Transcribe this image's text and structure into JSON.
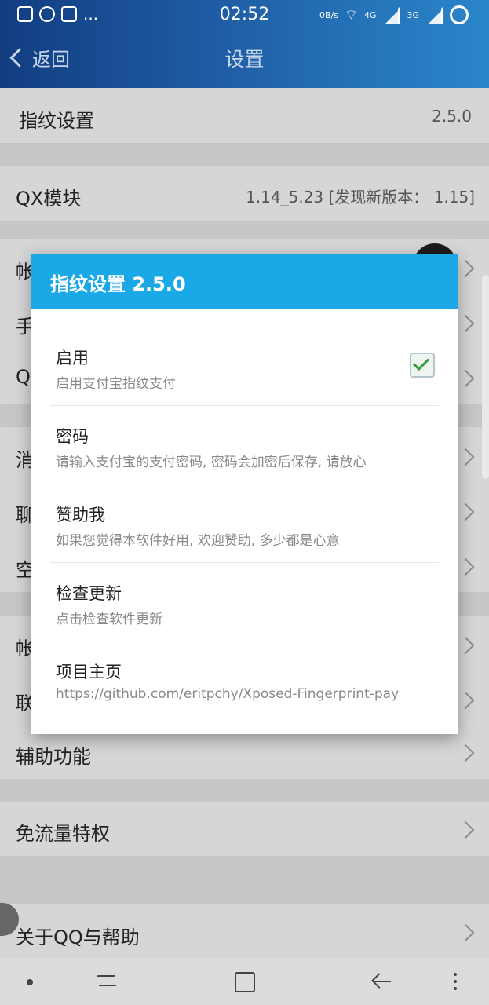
{
  "status_bar": {
    "time": "02:52",
    "left_extra": "...",
    "net_speed": "0B/s",
    "net_4g": "4G",
    "net_3g": "3G"
  },
  "header": {
    "back_label": "返回",
    "title": "设置"
  },
  "settings_list": [
    {
      "label": "指纹设置",
      "value": "2.5.0"
    },
    {
      "label": "QX模块",
      "value": "1.14_5.23 [发现新版本： 1.15]"
    },
    {
      "label": "帐"
    },
    {
      "label": "手"
    },
    {
      "label": "Q"
    },
    {
      "label": "消"
    },
    {
      "label": "聊"
    },
    {
      "label": "空"
    },
    {
      "label": "帐"
    },
    {
      "label": "联"
    },
    {
      "label": "辅助功能"
    },
    {
      "label": "免流量特权"
    },
    {
      "label": "关于QQ与帮助"
    }
  ],
  "dialog": {
    "title": "指纹设置 2.5.0",
    "items": [
      {
        "title": "启用",
        "subtitle": "启用支付宝指纹支付",
        "checked": true
      },
      {
        "title": "密码",
        "subtitle": "请输入支付宝的支付密码, 密码会加密后保存, 请放心"
      },
      {
        "title": "赞助我",
        "subtitle": "如果您觉得本软件好用, 欢迎赞助, 多少都是心意"
      },
      {
        "title": "检查更新",
        "subtitle": "点击检查软件更新"
      },
      {
        "title": "项目主页",
        "subtitle": "https://github.com/eritpchy/Xposed-Fingerprint-pay"
      }
    ]
  },
  "icons": {
    "back": "chevron-left-icon",
    "row": "chevron-right-icon",
    "checkbox": "checkmark-icon"
  },
  "colors": {
    "header_blue": "#1aa9e6",
    "nav_dark": "#123d80",
    "check_green": "#3a9a3a"
  }
}
